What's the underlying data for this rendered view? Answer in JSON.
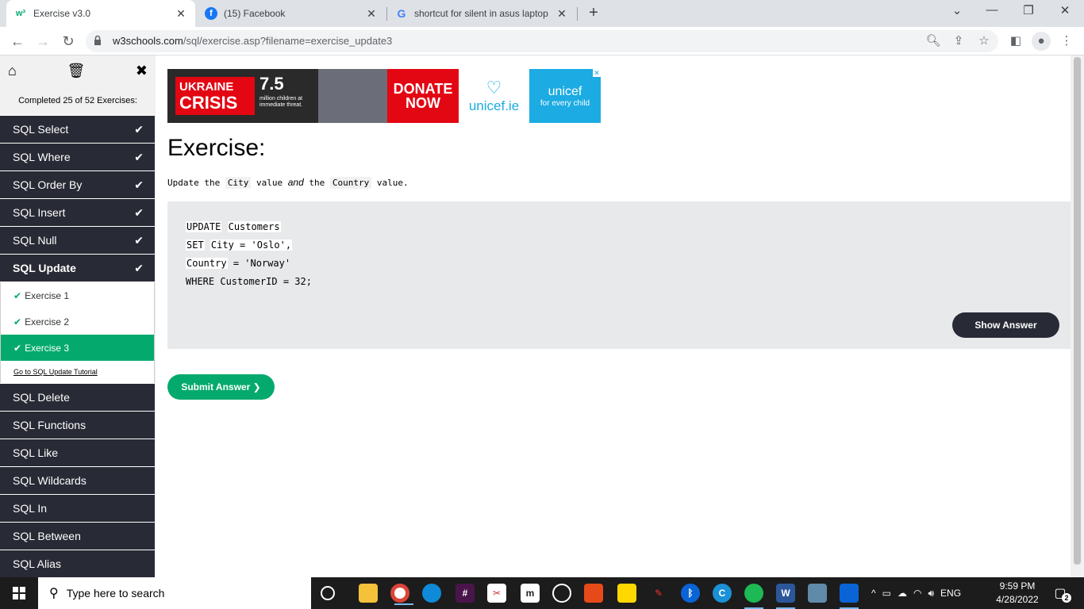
{
  "browser": {
    "tabs": [
      {
        "title": "Exercise v3.0",
        "favicon": "w3schools-icon",
        "active": true
      },
      {
        "title": "(15) Facebook",
        "favicon": "facebook-icon",
        "active": false
      },
      {
        "title": "shortcut for silent in asus laptop",
        "favicon": "google-icon",
        "active": false
      }
    ],
    "url_domain": "w3schools.com",
    "url_path": "/sql/exercise.asp?filename=exercise_update3"
  },
  "sidebar": {
    "progress": "Completed 25 of 52 Exercises:",
    "items_top": [
      {
        "label": "SQL Select"
      },
      {
        "label": "SQL Where"
      },
      {
        "label": "SQL Order By"
      },
      {
        "label": "SQL Insert"
      },
      {
        "label": "SQL Null"
      },
      {
        "label": "SQL Update"
      }
    ],
    "sub_items": [
      {
        "label": "Exercise 1"
      },
      {
        "label": "Exercise 2"
      },
      {
        "label": "Exercise 3"
      }
    ],
    "tutorial_link": "Go to SQL Update Tutorial",
    "items_bottom": [
      {
        "label": "SQL Delete"
      },
      {
        "label": "SQL Functions"
      },
      {
        "label": "SQL Like"
      },
      {
        "label": "SQL Wildcards"
      },
      {
        "label": "SQL In"
      },
      {
        "label": "SQL Between"
      },
      {
        "label": "SQL Alias"
      }
    ]
  },
  "ad": {
    "ukraine": "UKRAINE",
    "crisis": "CRISIS",
    "number": "7.5",
    "subtext": "million children at immediate threat.",
    "donate": "DONATE NOW",
    "unicef_ie": "unicef.ie",
    "unicef": "unicef",
    "tagline": "for every child"
  },
  "exercise": {
    "title": "Exercise:",
    "instr_1": "Update the",
    "instr_city": "City",
    "instr_2": "value",
    "instr_and": "and",
    "instr_3": "the",
    "instr_country": "Country",
    "instr_4": "value.",
    "code": {
      "l1_kw": "UPDATE",
      "l1_val": "Customers",
      "l2_kw": "SET",
      "l2_val": "City = 'Oslo',",
      "l3_kw": "Country",
      "l3_val": "= 'Norway'",
      "l4": "WHERE CustomerID = 32;"
    },
    "show_answer": "Show Answer",
    "submit": "Submit Answer ❯"
  },
  "taskbar": {
    "search_placeholder": "Type here to search",
    "language": "ENG",
    "time": "9:59 PM",
    "date": "4/28/2022",
    "notifications": "2"
  }
}
